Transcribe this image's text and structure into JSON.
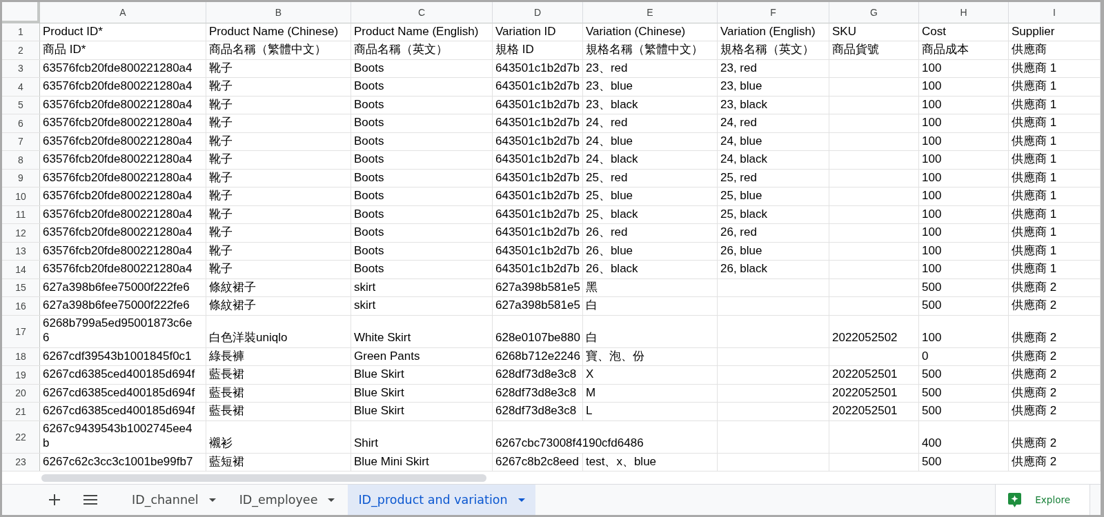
{
  "sheet": {
    "columns": [
      "A",
      "B",
      "C",
      "D",
      "E",
      "F",
      "G",
      "H",
      "I"
    ],
    "rows": [
      {
        "number": "1",
        "cells": {
          "A": "Product ID*",
          "B": "Product Name (Chinese)",
          "C": "Product Name (English)",
          "D": "Variation ID",
          "E": "Variation (Chinese)",
          "F": "Variation (English)",
          "G": "SKU",
          "H": "Cost",
          "I": "Supplier"
        }
      },
      {
        "number": "2",
        "cells": {
          "A": "商品 ID*",
          "B": "商品名稱（繁體中文）",
          "C": "商品名稱（英文）",
          "D": "規格 ID",
          "E": "規格名稱（繁體中文）",
          "F": "規格名稱（英文）",
          "G": "商品貨號",
          "H": "商品成本",
          "I": "供應商"
        }
      },
      {
        "number": "3",
        "cells": {
          "A": "63576fcb20fde800221280a4",
          "B": "靴子",
          "C": "Boots",
          "D": "643501c1b2d7b",
          "E": "23、red",
          "F": "23, red",
          "H": "100",
          "I": "供應商 1"
        }
      },
      {
        "number": "4",
        "cells": {
          "A": "63576fcb20fde800221280a4",
          "B": "靴子",
          "C": "Boots",
          "D": "643501c1b2d7b",
          "E": "23、blue",
          "F": "23, blue",
          "H": "100",
          "I": "供應商 1"
        }
      },
      {
        "number": "5",
        "cells": {
          "A": "63576fcb20fde800221280a4",
          "B": "靴子",
          "C": "Boots",
          "D": "643501c1b2d7b",
          "E": "23、black",
          "F": "23, black",
          "H": "100",
          "I": "供應商 1"
        }
      },
      {
        "number": "6",
        "cells": {
          "A": "63576fcb20fde800221280a4",
          "B": "靴子",
          "C": "Boots",
          "D": "643501c1b2d7b",
          "E": "24、red",
          "F": "24, red",
          "H": "100",
          "I": "供應商 1"
        }
      },
      {
        "number": "7",
        "cells": {
          "A": "63576fcb20fde800221280a4",
          "B": "靴子",
          "C": "Boots",
          "D": "643501c1b2d7b",
          "E": "24、blue",
          "F": "24, blue",
          "H": "100",
          "I": "供應商 1"
        }
      },
      {
        "number": "8",
        "cells": {
          "A": "63576fcb20fde800221280a4",
          "B": "靴子",
          "C": "Boots",
          "D": "643501c1b2d7b",
          "E": "24、black",
          "F": "24, black",
          "H": "100",
          "I": "供應商 1"
        }
      },
      {
        "number": "9",
        "cells": {
          "A": "63576fcb20fde800221280a4",
          "B": "靴子",
          "C": "Boots",
          "D": "643501c1b2d7b",
          "E": "25、red",
          "F": "25, red",
          "H": "100",
          "I": "供應商 1"
        }
      },
      {
        "number": "10",
        "cells": {
          "A": "63576fcb20fde800221280a4",
          "B": "靴子",
          "C": "Boots",
          "D": "643501c1b2d7b",
          "E": "25、blue",
          "F": "25, blue",
          "H": "100",
          "I": "供應商 1"
        }
      },
      {
        "number": "11",
        "cells": {
          "A": "63576fcb20fde800221280a4",
          "B": "靴子",
          "C": "Boots",
          "D": "643501c1b2d7b",
          "E": "25、black",
          "F": "25, black",
          "H": "100",
          "I": "供應商 1"
        }
      },
      {
        "number": "12",
        "cells": {
          "A": "63576fcb20fde800221280a4",
          "B": "靴子",
          "C": "Boots",
          "D": "643501c1b2d7b",
          "E": "26、red",
          "F": "26, red",
          "H": "100",
          "I": "供應商 1"
        }
      },
      {
        "number": "13",
        "cells": {
          "A": "63576fcb20fde800221280a4",
          "B": "靴子",
          "C": "Boots",
          "D": "643501c1b2d7b",
          "E": "26、blue",
          "F": "26, blue",
          "H": "100",
          "I": "供應商 1"
        }
      },
      {
        "number": "14",
        "cells": {
          "A": "63576fcb20fde800221280a4",
          "B": "靴子",
          "C": "Boots",
          "D": "643501c1b2d7b",
          "E": "26、black",
          "F": "26, black",
          "H": "100",
          "I": "供應商 1"
        }
      },
      {
        "number": "15",
        "cells": {
          "A": "627a398b6fee75000f222fe6",
          "B": "條紋裙子",
          "C": "skirt",
          "D": "627a398b581e5",
          "E": "黑",
          "H": "500",
          "I": "供應商 2"
        }
      },
      {
        "number": "16",
        "cells": {
          "A": "627a398b6fee75000f222fe6",
          "B": "條紋裙子",
          "C": "skirt",
          "D": "627a398b581e5",
          "E": "白",
          "H": "500",
          "I": "供應商 2"
        }
      },
      {
        "number": "17",
        "cells": {
          "A": "6268b799a5ed95001873c6e6",
          "B": "白色洋裝uniqlo",
          "C": "White Skirt",
          "D": "628e0107be880",
          "E": "白",
          "G": "2022052502",
          "H": "100",
          "I": "供應商 2"
        }
      },
      {
        "number": "18",
        "cells": {
          "A": "6267cdf39543b1001845f0c1",
          "B": "綠長褲",
          "C": "Green Pants",
          "D": "6268b712e2246",
          "E": "寶、泡、份",
          "H": "0",
          "I": "供應商 2"
        }
      },
      {
        "number": "19",
        "cells": {
          "A": "6267cd6385ced400185d694f",
          "B": "藍長裙",
          "C": "Blue Skirt",
          "D": "628df73d8e3c8",
          "E": "X",
          "G": "2022052501",
          "H": "500",
          "I": "供應商 2"
        }
      },
      {
        "number": "20",
        "cells": {
          "A": "6267cd6385ced400185d694f",
          "B": "藍長裙",
          "C": "Blue Skirt",
          "D": "628df73d8e3c8",
          "E": "M",
          "G": "2022052501",
          "H": "500",
          "I": "供應商 2"
        }
      },
      {
        "number": "21",
        "cells": {
          "A": "6267cd6385ced400185d694f",
          "B": "藍長裙",
          "C": "Blue Skirt",
          "D": "628df73d8e3c8",
          "E": "L",
          "G": "2022052501",
          "H": "500",
          "I": "供應商 2"
        }
      },
      {
        "number": "22",
        "cells": {
          "A": "6267c9439543b1002745ee4b",
          "B": "襯衫",
          "C": "Shirt",
          "D": "6267cbc73008f4190cfd6486",
          "H": "400",
          "I": "供應商 2"
        }
      },
      {
        "number": "23",
        "cells": {
          "A": "6267c62c3cc3c1001be99fb7",
          "B": "藍短裙",
          "C": "Blue Mini Skirt",
          "D": "6267c8b2c8eed",
          "E": "test、x、blue",
          "H": "500",
          "I": "供應商 2"
        }
      }
    ]
  },
  "sheet_tabs": [
    {
      "label": "ID_channel",
      "selected": false
    },
    {
      "label": "ID_employee",
      "selected": false
    },
    {
      "label": "ID_product and variation",
      "selected": true
    }
  ],
  "explore_button": {
    "label": "Explore"
  }
}
